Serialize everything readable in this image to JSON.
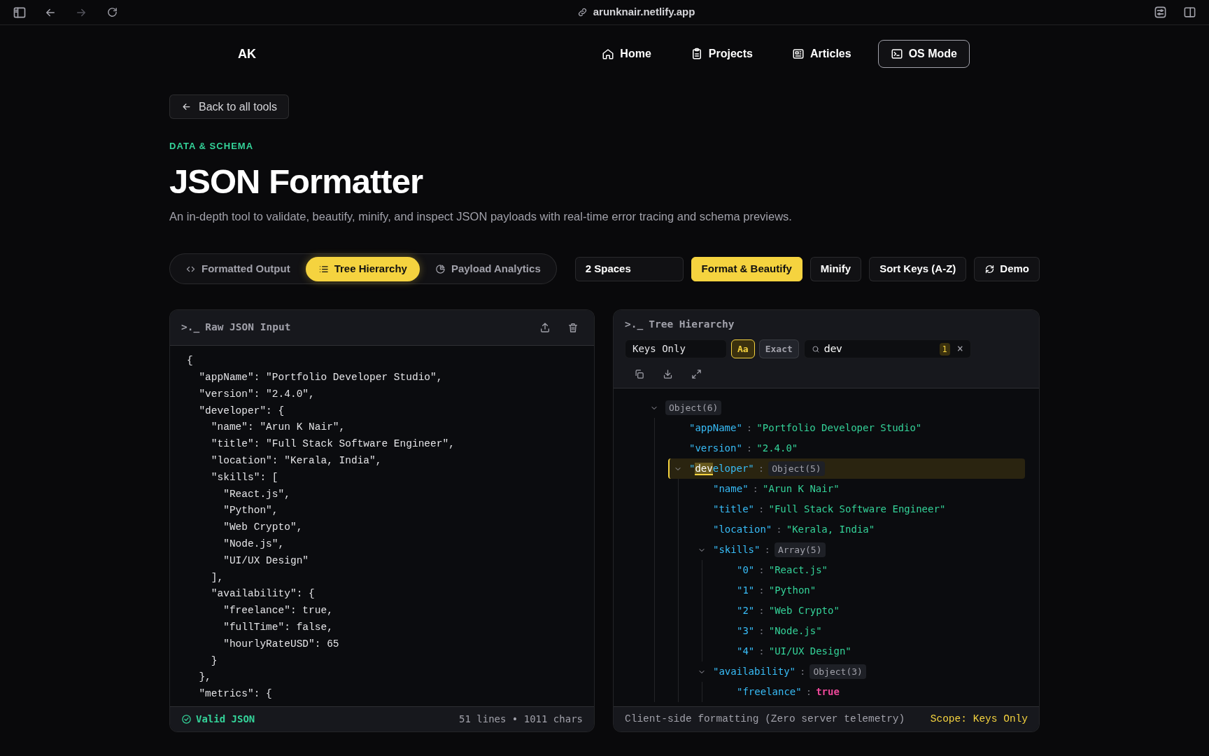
{
  "browser": {
    "url": "arunknair.netlify.app",
    "forward_disabled": true
  },
  "nav": {
    "logo": "AK",
    "links": [
      {
        "label": "Home",
        "selected": false
      },
      {
        "label": "Projects",
        "selected": false
      },
      {
        "label": "Articles",
        "selected": false
      },
      {
        "label": "OS Mode",
        "selected": true
      }
    ]
  },
  "back_link": "Back to all tools",
  "eyebrow": "DATA & SCHEMA",
  "title": "JSON Formatter",
  "subtitle": "An in-depth tool to validate, beautify, minify, and inspect JSON payloads with real-time error tracing and schema previews.",
  "view_tabs": [
    {
      "label": "Formatted Output",
      "selected": false
    },
    {
      "label": "Tree Hierarchy",
      "selected": true
    },
    {
      "label": "Payload Analytics",
      "selected": false
    }
  ],
  "indent_select": "2 Spaces",
  "actions": [
    {
      "label": "Format & Beautify",
      "kind": "primary"
    },
    {
      "label": "Minify",
      "kind": "secondary"
    },
    {
      "label": "Sort Keys (A-Z)",
      "kind": "secondary"
    },
    {
      "label": "Demo",
      "kind": "refresh"
    }
  ],
  "input_panel": {
    "prompt": ">._",
    "title": "Raw JSON Input",
    "lines": [
      "{",
      "  \"appName\": \"Portfolio Developer Studio\",",
      "  \"version\": \"2.4.0\",",
      "  \"developer\": {",
      "    \"name\": \"Arun K Nair\",",
      "    \"title\": \"Full Stack Software Engineer\",",
      "    \"location\": \"Kerala, India\",",
      "    \"skills\": [",
      "      \"React.js\",",
      "      \"Python\",",
      "      \"Web Crypto\",",
      "      \"Node.js\",",
      "      \"UI/UX Design\"",
      "    ],",
      "    \"availability\": {",
      "      \"freelance\": true,",
      "      \"fullTime\": false,",
      "      \"hourlyRateUSD\": 65",
      "    }",
      "  },",
      "  \"metrics\": {"
    ],
    "status": "Valid JSON",
    "valid": true,
    "stats": "51 lines • 1011 chars"
  },
  "tree_panel": {
    "prompt": ">._",
    "title": "Tree Hierarchy",
    "scope_select": "Keys Only",
    "toggles": [
      {
        "label": "Aa",
        "on": true
      },
      {
        "label": "Exact",
        "on": false
      }
    ],
    "search": {
      "value": "dev",
      "count": "1",
      "clear": "×"
    },
    "root": {
      "kind": "object",
      "badge": "Object(6)",
      "expanded": true,
      "children": [
        {
          "kind": "string",
          "key": "\"appName\"",
          "colon": ":",
          "value": "\"Portfolio Developer Studio\""
        },
        {
          "kind": "string",
          "key": "\"version\"",
          "colon": ":",
          "value": "\"2.4.0\""
        },
        {
          "kind": "object",
          "matched": true,
          "key_parts": [
            {
              "text": "\"",
              "highlight": false
            },
            {
              "text": "dev",
              "highlight": true
            },
            {
              "text": "eloper\"",
              "highlight": false
            }
          ],
          "colon": ":",
          "badge": "Object(5)",
          "expanded": true,
          "children": [
            {
              "kind": "string",
              "key": "\"name\"",
              "colon": ":",
              "value": "\"Arun K Nair\""
            },
            {
              "kind": "string",
              "key": "\"title\"",
              "colon": ":",
              "value": "\"Full Stack Software Engineer\""
            },
            {
              "kind": "string",
              "key": "\"location\"",
              "colon": ":",
              "value": "\"Kerala, India\""
            },
            {
              "kind": "array",
              "key": "\"skills\"",
              "colon": ":",
              "badge": "Array(5)",
              "expanded": true,
              "children": [
                {
                  "kind": "string",
                  "key": "\"0\"",
                  "colon": ":",
                  "value": "\"React.js\""
                },
                {
                  "kind": "string",
                  "key": "\"1\"",
                  "colon": ":",
                  "value": "\"Python\""
                },
                {
                  "kind": "string",
                  "key": "\"2\"",
                  "colon": ":",
                  "value": "\"Web Crypto\""
                },
                {
                  "kind": "string",
                  "key": "\"3\"",
                  "colon": ":",
                  "value": "\"Node.js\""
                },
                {
                  "kind": "string",
                  "key": "\"4\"",
                  "colon": ":",
                  "value": "\"UI/UX Design\""
                }
              ]
            },
            {
              "kind": "object",
              "key": "\"availability\"",
              "colon": ":",
              "badge": "Object(3)",
              "expanded": true,
              "children": [
                {
                  "kind": "boolean",
                  "key": "\"freelance\"",
                  "colon": ":",
                  "value": "true"
                }
              ]
            }
          ]
        }
      ]
    },
    "footer_note": "Client-side formatting (Zero server telemetry)",
    "scope_label": "Scope: Keys Only"
  }
}
